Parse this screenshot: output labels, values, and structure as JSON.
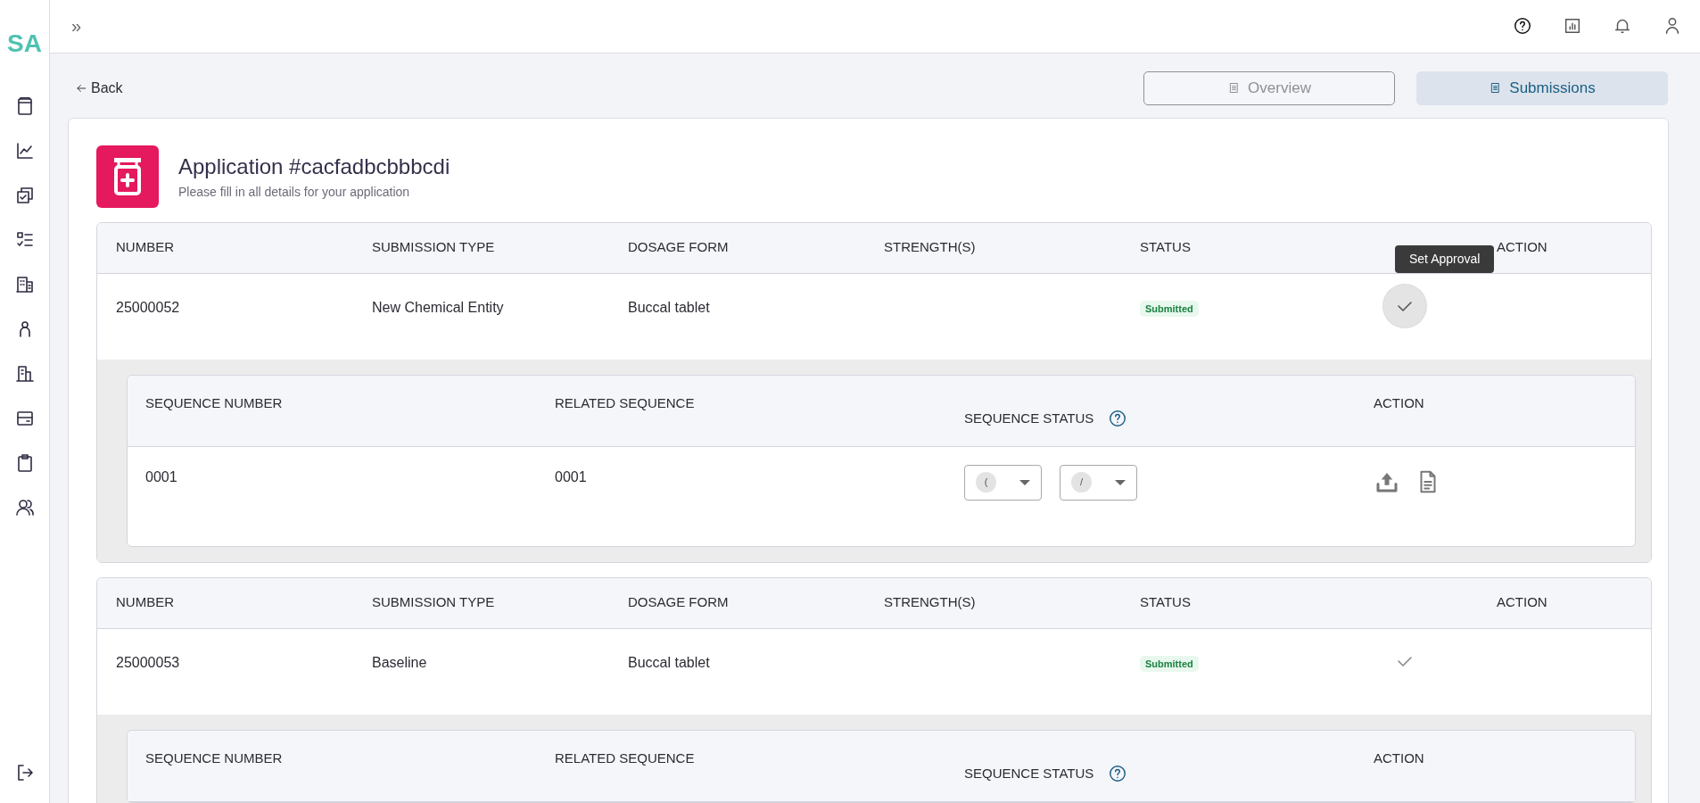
{
  "sidebar": {
    "logo": "SA"
  },
  "topbar": {
    "expand_glyph": "»"
  },
  "back": "Back",
  "tabs": [
    {
      "label": "Overview",
      "selected": false
    },
    {
      "label": "Submissions",
      "selected": true
    }
  ],
  "application": {
    "title": "Application #cacfadbcbbbcdi",
    "subtitle": "Please fill in all details for your application"
  },
  "submissions": [
    {
      "columns": [
        "NUMBER",
        "SUBMISSION TYPE",
        "DOSAGE FORM",
        "STRENGTH(S)",
        "STATUS",
        "ACTION"
      ],
      "number": "25000052",
      "submission_type": "New Chemical Entity",
      "dosage_form": "Buccal tablet",
      "status": "Submitted",
      "approve_hovered": true,
      "tooltip": "Set Approval",
      "sequences": {
        "columns": [
          "SEQUENCE NUMBER",
          "RELATED SEQUENCE",
          "SEQUENCE STATUS",
          "ACTION"
        ],
        "rows": [
          {
            "sequence_number": "0001",
            "related_sequence": "0001",
            "status_selects": [
              "(",
              "/"
            ]
          }
        ]
      }
    },
    {
      "columns": [
        "NUMBER",
        "SUBMISSION TYPE",
        "DOSAGE FORM",
        "STRENGTH(S)",
        "STATUS",
        "ACTION"
      ],
      "number": "25000053",
      "submission_type": "Baseline",
      "dosage_form": "Buccal tablet",
      "status": "Submitted",
      "approve_hovered": false,
      "sequences": {
        "columns": [
          "SEQUENCE NUMBER",
          "RELATED SEQUENCE",
          "SEQUENCE STATUS",
          "ACTION"
        ]
      }
    }
  ]
}
